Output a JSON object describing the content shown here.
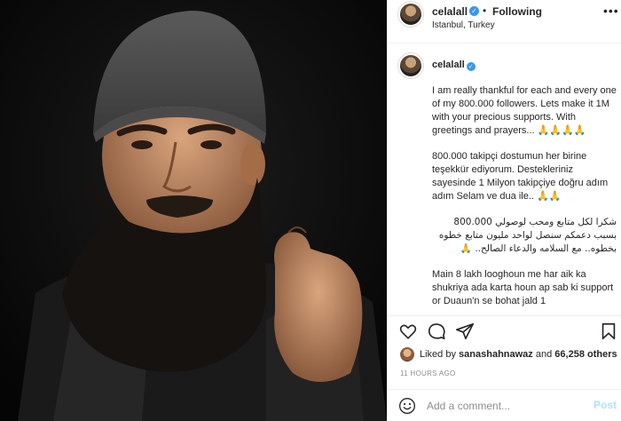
{
  "post": {
    "username": "celalall",
    "following_label": "Following",
    "location": "Istanbul, Turkey"
  },
  "caption": {
    "username": "celalall",
    "paragraphs": [
      "I am really thankful for each and every one of my 800.000 followers. Lets make it 1M with your precious supports. With greetings and prayers... 🙏🙏🙏🙏",
      "800.000 takipçi dostumun her birine teşekkür ediyorum. Destekleriniz sayesinde 1 Milyon takipçiye doğru adım adım Selam ve dua ile.. 🙏🙏",
      "شكرا لكل متابع ومحب لوصولي 800.000 بسبب دعمكم سنصل لواحد مليون متابع خطوه بخطوه.. مع السلامه والدعاء الصالح.. 🙏",
      "Main 8 lakh looghoun me har aik ka shukriya ada karta houn ap sab ki support or Duaun'n se bohat jald 1"
    ]
  },
  "likes": {
    "prefix": "Liked by",
    "user": "sanashahnawaz",
    "joiner": "and",
    "count": "66,258 others"
  },
  "timestamp": "11 HOURS AGO",
  "comment_box": {
    "placeholder": "Add a comment...",
    "post_label": "Post"
  },
  "icons": {
    "verified": "verified-badge-icon",
    "more": "more-options-icon",
    "like": "heart-icon",
    "comment": "comment-bubble-icon",
    "share": "paper-plane-icon",
    "save": "bookmark-icon",
    "emoji": "smiley-icon"
  },
  "colors": {
    "verified_blue": "#3897f0",
    "post_button_disabled": "#b2dffc",
    "muted_text": "#8e8e8e",
    "border": "#efefef"
  }
}
